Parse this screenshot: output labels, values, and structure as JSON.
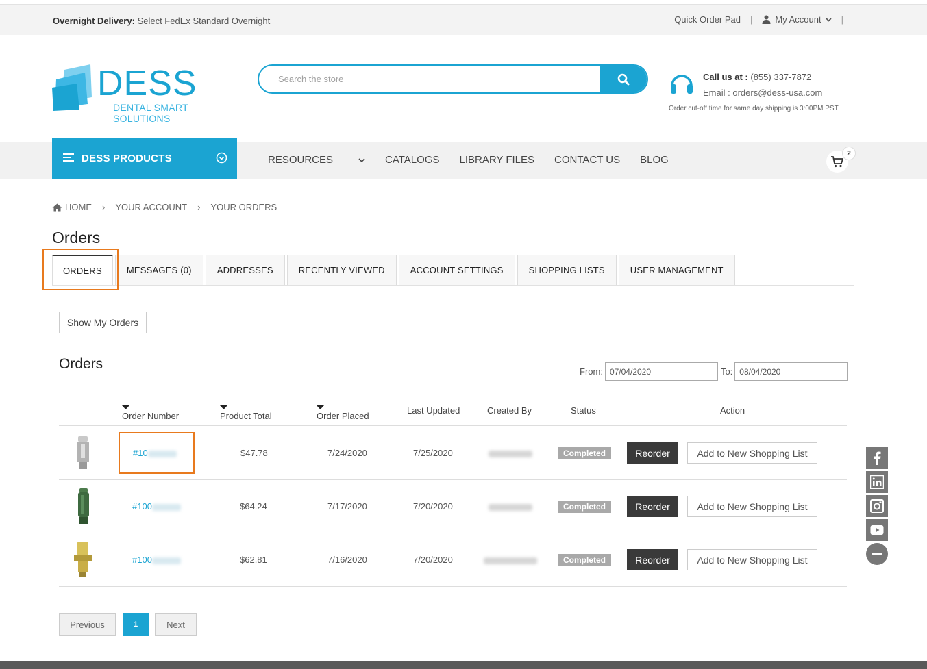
{
  "topbar": {
    "delivery_label": "Overnight Delivery:",
    "delivery_text": "Select FedEx Standard Overnight",
    "quick_order": "Quick Order Pad",
    "my_account": "My Account"
  },
  "brand": {
    "name": "DESS",
    "tagline": "DENTAL SMART SOLUTIONS",
    "accent": "#1ba4d2"
  },
  "search": {
    "placeholder": "Search the store"
  },
  "contact": {
    "call_label": "Call us at :",
    "phone": "(855) 337-7872",
    "email_label": "Email :",
    "email": "orders@dess-usa.com",
    "cutoff": "Order cut-off time for same day shipping is 3:00PM PST"
  },
  "nav": {
    "products": "DESS PRODUCTS",
    "links": [
      "RESOURCES",
      "CATALOGS",
      "LIBRARY FILES",
      "CONTACT US",
      "BLOG"
    ],
    "cart_count": "2"
  },
  "breadcrumb": [
    "HOME",
    "YOUR ACCOUNT",
    "YOUR ORDERS"
  ],
  "page_title": "Orders",
  "tabs": [
    "ORDERS",
    "MESSAGES (0)",
    "ADDRESSES",
    "RECENTLY VIEWED",
    "ACCOUNT SETTINGS",
    "SHOPPING LISTS",
    "USER MANAGEMENT"
  ],
  "show_orders": "Show My Orders",
  "orders_heading": "Orders",
  "range": {
    "from_label": "From:",
    "from": "07/04/2020",
    "to_label": "To:",
    "to": "08/04/2020"
  },
  "columns": [
    "Order Number",
    "Product Total",
    "Order Placed",
    "Last Updated",
    "Created By",
    "Status",
    "Action"
  ],
  "orders": [
    {
      "number": "#10",
      "total": "$47.78",
      "placed": "7/24/2020",
      "updated": "7/25/2020",
      "status": "Completed",
      "reorder": "Reorder",
      "add_list": "Add to New Shopping List"
    },
    {
      "number": "#100",
      "total": "$64.24",
      "placed": "7/17/2020",
      "updated": "7/20/2020",
      "status": "Completed",
      "reorder": "Reorder",
      "add_list": "Add to New Shopping List"
    },
    {
      "number": "#100",
      "total": "$62.81",
      "placed": "7/16/2020",
      "updated": "7/20/2020",
      "status": "Completed",
      "reorder": "Reorder",
      "add_list": "Add to New Shopping List"
    }
  ],
  "pagination": {
    "prev": "Previous",
    "page": "1",
    "next": "Next"
  },
  "social_icons": [
    "facebook-icon",
    "linkedin-icon",
    "instagram-icon",
    "youtube-icon",
    "minus-icon"
  ]
}
